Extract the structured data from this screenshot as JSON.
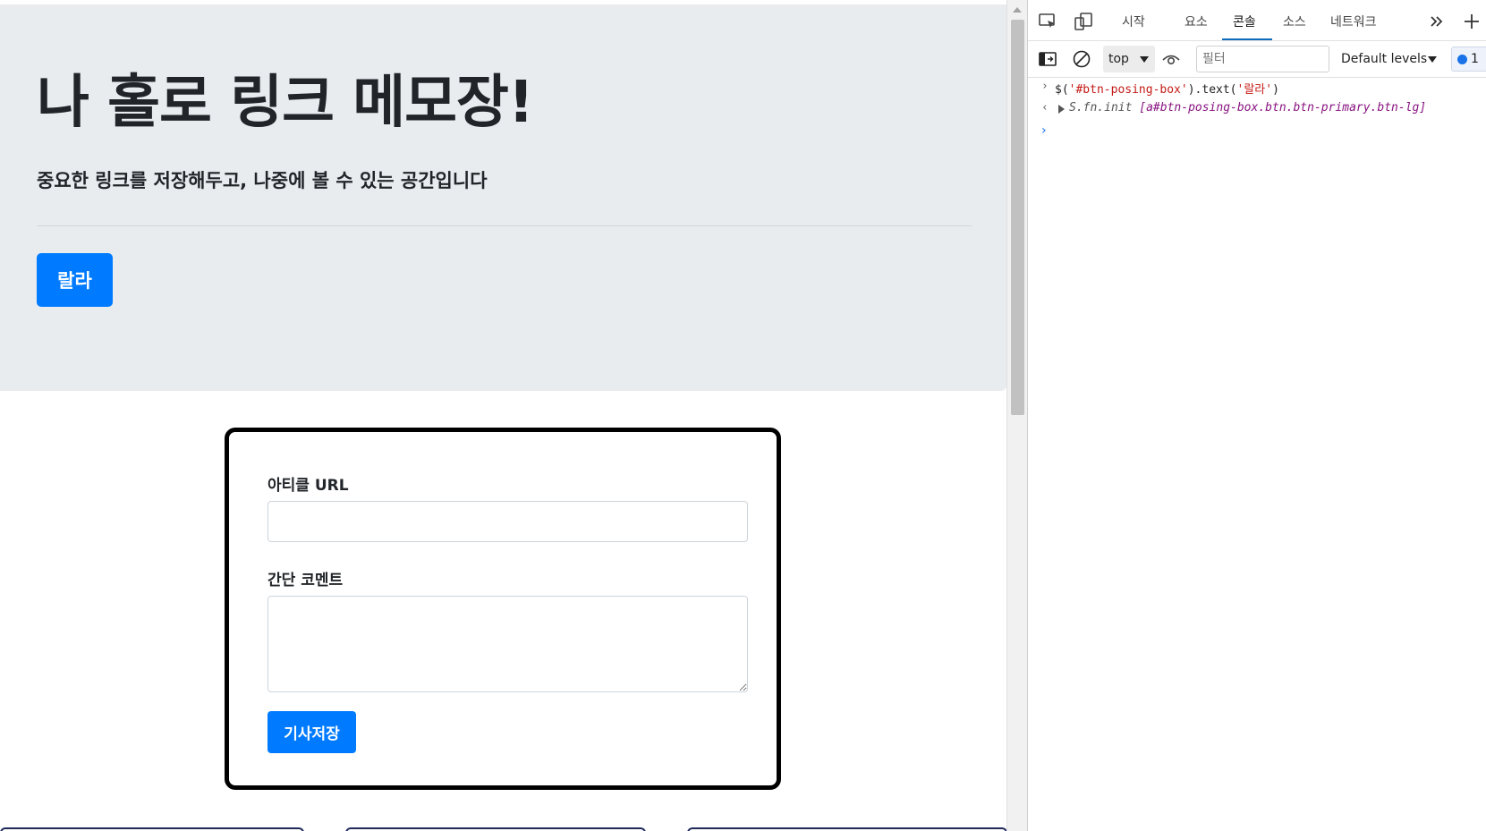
{
  "page": {
    "hero": {
      "title": "나 홀로 링크 메모장!",
      "subtitle": "중요한 링크를 저장해두고, 나중에 볼 수 있는 공간입니다",
      "button_label": "랄라"
    },
    "form": {
      "url_label": "아티클 URL",
      "url_value": "",
      "comment_label": "간단 코멘트",
      "comment_value": "",
      "save_label": "기사저장"
    }
  },
  "devtools": {
    "tabs": [
      "시작",
      "요소",
      "콘솔",
      "소스",
      "네트워크"
    ],
    "active_tab": "콘솔",
    "toolbar": {
      "context": "top",
      "filter_placeholder": "필터",
      "levels": "Default levels",
      "issues_count": "1"
    },
    "console": {
      "command": {
        "prefix": "$(",
        "selector": "'#btn-posing-box'",
        "method": ").text(",
        "arg": "'랄라'",
        "suffix": ")"
      },
      "result": {
        "object": "S.fn.init",
        "detail": "[a#btn-posing-box.btn.btn-primary.btn-lg]"
      }
    }
  },
  "colors": {
    "primary": "#007bff",
    "jumbotron_bg": "#e9ecef",
    "devtools_accent": "#0f6cbd"
  }
}
